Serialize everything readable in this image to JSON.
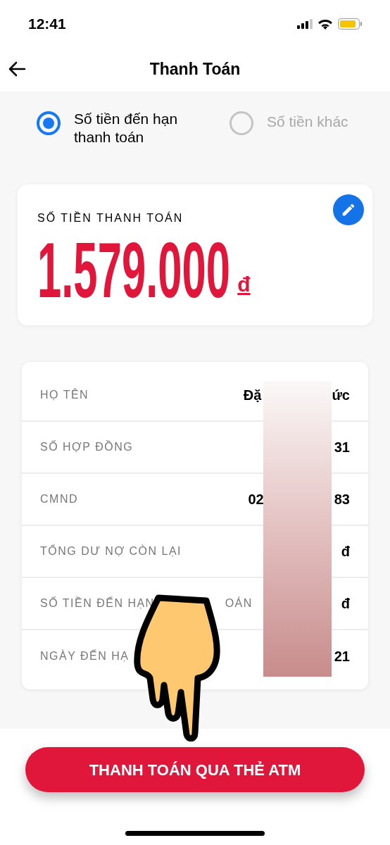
{
  "status_bar": {
    "time": "12:41"
  },
  "header": {
    "title": "Thanh Toán"
  },
  "payment_options": [
    {
      "label": "Số tiền đến hạn thanh toán",
      "selected": true
    },
    {
      "label": "Số tiền khác",
      "selected": false
    }
  ],
  "amount_card": {
    "label": "SỐ TIỀN THANH TOÁN",
    "amount": "1.579.000",
    "currency": "đ"
  },
  "details": [
    {
      "label": "HỌ TÊN",
      "value_start": "Đặ",
      "value_end": "ức"
    },
    {
      "label": "SỐ HỢP ĐỒNG",
      "value_end": "31"
    },
    {
      "label": "CMND",
      "value_start": "02",
      "value_end": "83"
    },
    {
      "label": "TỔNG DƯ NỢ CÒN LẠI",
      "value_end": "đ"
    },
    {
      "label": "SỐ TIỀN ĐẾN HẠN",
      "label_end": "OÁN",
      "value_end": "đ"
    },
    {
      "label": "NGÀY ĐẾN HẠ",
      "value_end": "21"
    }
  ],
  "pay_button": {
    "label": "THANH TOÁN QUA THẺ ATM"
  }
}
